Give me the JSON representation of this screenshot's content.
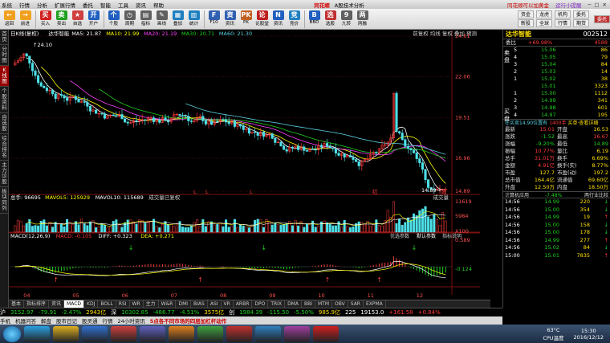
{
  "menubar": {
    "items": [
      "系统",
      "行情",
      "分析",
      "扩展行情",
      "委托",
      "智能",
      "工具",
      "资讯",
      "帮助"
    ],
    "brand": "同花顺",
    "title": "A股技术分析",
    "ad1": "同花顺可以加黄金",
    "ad2": "运行小提醒"
  },
  "toolbar": {
    "buttons": [
      "返回",
      "前进",
      "买入",
      "卖出",
      "自选",
      "开户",
      "个股",
      "周期",
      "指标",
      "画线",
      "叠加",
      "统计",
      "F10",
      "资讯",
      "PK",
      "论股堂",
      "资讯",
      "竞价",
      "BBD",
      "选股",
      "九转",
      "两融"
    ],
    "right_btns": [
      "资金",
      "龙虎",
      "机构",
      "委托",
      "新股",
      "全球",
      "行情",
      "期货",
      "港股",
      "沪港通",
      "美股"
    ],
    "user": "委托",
    "login": "登录"
  },
  "sidebar": {
    "tabs": [
      "首页",
      "分时图",
      "K线图",
      "个股资料",
      "自选股",
      "综合排名",
      "主力诊股",
      "板块同列"
    ],
    "active": 2
  },
  "chart": {
    "header_items": [
      "日K线(复权)",
      "达华智能",
      "MA5: 21.87",
      "MA10: 21.99",
      "MA20: 21.19",
      "MA30: 20.71",
      "MA60: 21.30"
    ],
    "header_colors": [
      "#ffffff",
      "#ffffff",
      "#ffffff",
      "#ffff00",
      "#ff40ff",
      "#20d020",
      "#5ad0e0"
    ],
    "header_right": "前复权 均线 复权 叠加 预测",
    "price_ticks": [
      "24.61",
      "22.06",
      "19.51",
      "16.96",
      "14.89"
    ],
    "high_label": "24.10",
    "low_label": "14.89",
    "vol_header": [
      "总手: 96695",
      "MAVOL5: 125929",
      "MAVOL10: 115689",
      "成交量已复权"
    ],
    "vol_header_colors": [
      "#ffffff",
      "#ffff00",
      "#ffffff",
      "#cccccc"
    ],
    "vol_ticks": [
      "11619",
      "5984",
      "X100"
    ],
    "vol_btn": "成交量",
    "macd_header": [
      "MACD(12,26,9)",
      "MACD: -0.105",
      "DIFF: +0.323",
      "DEA: +0.271"
    ],
    "macd_header_colors": [
      "#ffffff",
      "#ff3b3b",
      "#ffffff",
      "#ffff00"
    ],
    "macd_btns": [
      "优选参数",
      "默认参数",
      "指标说明"
    ],
    "macd_ticks": [
      "0.589",
      "-0.124"
    ],
    "x_labels": [
      "04",
      "05",
      "06",
      "07",
      "08",
      "09",
      "10",
      "11",
      "12"
    ],
    "markers": [
      "L",
      "L",
      "L",
      "红",
      "涨"
    ]
  },
  "chart_data": {
    "type": "candlestick",
    "title": "达华智能 日K线",
    "price_range": [
      14.89,
      24.61
    ],
    "high": 24.1,
    "low": 14.89,
    "ma": {
      "MA5": 21.87,
      "MA10": 21.99,
      "MA20": 21.19,
      "MA30": 20.71,
      "MA60": 21.3
    },
    "volume": {
      "total": 96695,
      "MAVOL5": 125929,
      "MAVOL10": 115689
    },
    "macd": {
      "MACD": -0.105,
      "DIFF": 0.323,
      "DEA": 0.271
    }
  },
  "bottomtabs": [
    "基本",
    "指标排序",
    "资讯",
    "MACD",
    "KDJ",
    "BOLL",
    "RSI",
    "WR",
    "主力",
    "W&R",
    "DMI",
    "BIAS",
    "ASI",
    "VR",
    "ARBR",
    "DPO",
    "TRIX",
    "DMA",
    "BBI",
    "MTM",
    "OBV",
    "SAR",
    "EXPMA"
  ],
  "bottom_active": 3,
  "quote": {
    "name": "达华智能",
    "code": "002512",
    "weibi_label": "委比",
    "weibi": "+69.98%",
    "weibi_amt": "4588",
    "sell_label": "卖盘",
    "buy_label": "买盘",
    "sells": [
      [
        "5",
        "15.06",
        "86"
      ],
      [
        "4",
        "15.05",
        "79"
      ],
      [
        "3",
        "15.04",
        "84"
      ],
      [
        "2",
        "15.03",
        "14"
      ],
      [
        "1",
        "15.02",
        "38"
      ]
    ],
    "sell_extra": [
      "15.01",
      "3323"
    ],
    "buys": [
      [
        "1",
        "15.00",
        "1112"
      ],
      [
        "2",
        "14.99",
        "341"
      ],
      [
        "3",
        "14.98",
        "601"
      ],
      [
        "4",
        "14.97",
        "195"
      ]
    ],
    "bar_line": [
      "在买卖14.90位置有",
      "1400手",
      "买单·查看详细"
    ],
    "stats": [
      [
        "最新",
        "15.01",
        "开盘",
        "16.53"
      ],
      [
        "涨跌",
        "-1.52",
        "最高",
        "16.67"
      ],
      [
        "涨幅",
        "-9.20%",
        "最低",
        "14.89"
      ],
      [
        "振幅",
        "10.77%",
        "量比",
        "6.19"
      ],
      [
        "总手",
        "31.01万",
        "换手",
        "6.69%"
      ],
      [
        "金额",
        "4.91亿",
        "换手(实)",
        "8.77%"
      ],
      [
        "市盈",
        "127.7",
        "市盈(动)",
        "197.2"
      ],
      [
        "总市值",
        "164.4亿",
        "流通值",
        "69.60亿"
      ],
      [
        "外盘",
        "12.50万",
        "内盘",
        "18.50万"
      ]
    ],
    "calc_row": [
      "计算机应用",
      "-7.48%",
      "两行业比较"
    ],
    "ticks": [
      [
        "14:56",
        "14.99",
        "220",
        "down"
      ],
      [
        "14:56",
        "15.00",
        "354",
        "down"
      ],
      [
        "14:56",
        "14.99",
        "19",
        "up"
      ],
      [
        "14:56",
        "15.00",
        "158",
        "down"
      ],
      [
        "14:56",
        "15.00",
        "178",
        "down"
      ],
      [
        "14:56",
        "14.99",
        "277",
        "up"
      ],
      [
        "14:56",
        "15.02",
        "84",
        "down"
      ],
      [
        "15:00",
        "15.01",
        "7835",
        "up"
      ]
    ]
  },
  "status": {
    "idx1_name": "沪",
    "idx1_val": "3152.97",
    "idx1_chg": "-79.91",
    "idx1_pct": "-2.47%",
    "idx1_amt": "2943亿",
    "idx2_name": "深",
    "idx2_val": "10302.85",
    "idx2_chg": "-486.77",
    "idx2_pct": "-4.51%",
    "idx2_amt": "3575亿",
    "idx3_name": "创",
    "idx3_val": "1984.39",
    "idx3_chg": "-115.50",
    "idx3_pct": "-5.50%",
    "idx3_amt": "985.9亿",
    "idx3_extra": "225",
    "right": [
      "19153.0",
      "+161.58",
      "+0.84%"
    ]
  },
  "status2": {
    "items": [
      "手机",
      "机器问答",
      "解盘",
      "股市日记",
      "股灵通",
      "行情",
      "24小时资讯",
      "5点各不同市场的四层加杠杆动作"
    ]
  },
  "taskbar": {
    "temp": "63°C",
    "cpu": "CPU温度",
    "time": "15:30",
    "date": "2016/12/12"
  },
  "colors": {
    "up": "#ff3b3b",
    "down": "#20d020",
    "ma5": "#ffffff",
    "ma10": "#ffff00",
    "ma20": "#ff40ff",
    "ma30": "#20d020",
    "ma60": "#5ad0e0"
  }
}
